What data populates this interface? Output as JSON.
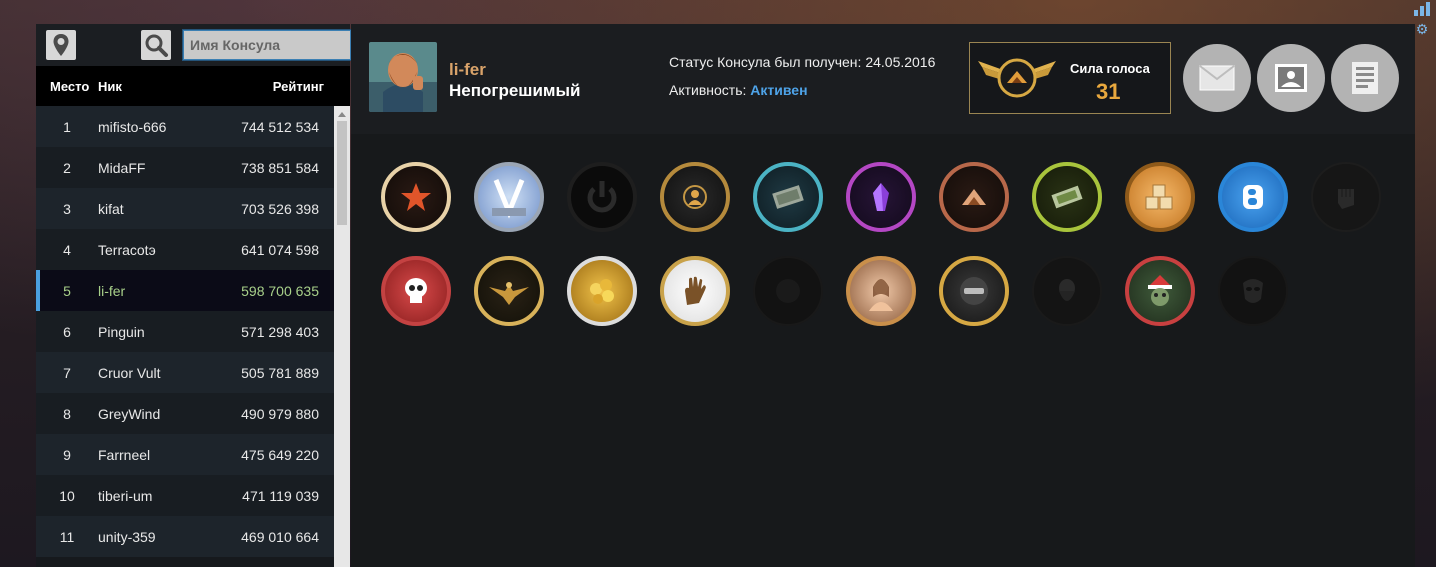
{
  "search": {
    "placeholder": "Имя Консула"
  },
  "leaderboard": {
    "headers": {
      "place": "Место",
      "nick": "Ник",
      "rating": "Рейтинг"
    },
    "rows": [
      {
        "place": "1",
        "nick": "mifisto-666",
        "rating": "744 512 534"
      },
      {
        "place": "2",
        "nick": "MidaFF",
        "rating": "738 851 584"
      },
      {
        "place": "3",
        "nick": "kifat",
        "rating": "703 526 398"
      },
      {
        "place": "4",
        "nick": "Terracotэ",
        "rating": "641 074 598"
      },
      {
        "place": "5",
        "nick": "li-fer",
        "rating": "598 700 635"
      },
      {
        "place": "6",
        "nick": "Pinguin",
        "rating": "571 298 403"
      },
      {
        "place": "7",
        "nick": "Cruor Vult",
        "rating": "505 781 889"
      },
      {
        "place": "8",
        "nick": "GreyWind",
        "rating": "490 979 880"
      },
      {
        "place": "9",
        "nick": "Farrneel",
        "rating": "475 649 220"
      },
      {
        "place": "10",
        "nick": "tiberi-um",
        "rating": "471 119 039"
      },
      {
        "place": "11",
        "nick": "unity-359",
        "rating": "469 010 664"
      }
    ],
    "selected_place": "5"
  },
  "profile": {
    "username": "li-fer",
    "title": "Непогрешимый",
    "status_text": "Статус Консула был получен: 24.05.2016",
    "activity_label": "Активность:",
    "activity_value": "Активен"
  },
  "vote": {
    "label": "Сила голоса",
    "value": "31"
  },
  "actions": [
    "envelope-icon",
    "picture-icon",
    "document-icon"
  ],
  "badges": [
    "star-badge",
    "v-badge",
    "power-badge",
    "person-badge",
    "money-badge",
    "crystal-badge",
    "pyramid-badge",
    "cash-badge",
    "boxes-badge",
    "vk-badge",
    "fist-badge",
    "skull-badge",
    "eagle-badge",
    "gold-badge",
    "hand-badge",
    "dark-badge",
    "portrait-badge",
    "minus-badge",
    "old-man-badge",
    "santa-badge",
    "mask-badge"
  ],
  "colors": {
    "accent_blue": "#4ea3e8",
    "gold": "#e8a83e",
    "username": "#d9a36a",
    "selected_rating": "#a8d08a"
  }
}
